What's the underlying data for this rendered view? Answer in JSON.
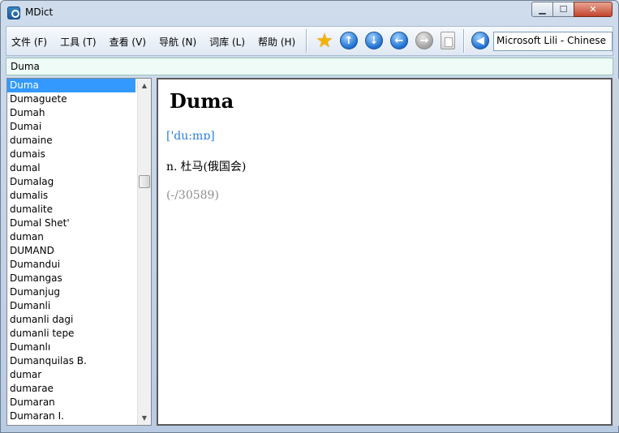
{
  "window": {
    "title": "MDict"
  },
  "menu": [
    {
      "label": "文件 (F)"
    },
    {
      "label": "工具 (T)"
    },
    {
      "label": "查看 (V)"
    },
    {
      "label": "导航 (N)"
    },
    {
      "label": "词库 (L)"
    },
    {
      "label": "帮助 (H)"
    }
  ],
  "toolbar": {
    "icons": [
      "star-icon",
      "arrow-up-icon",
      "arrow-down-icon",
      "arrow-left-icon",
      "arrow-right-icon",
      "paste-icon",
      "speaker-icon"
    ],
    "voice": "Microsoft Lili - Chinese"
  },
  "search": {
    "value": "Duma"
  },
  "word_list": {
    "selected": "Duma",
    "items": [
      "Duma",
      "Dumaguete",
      "Dumah",
      "Dumai",
      "dumaine",
      "dumais",
      "dumal",
      "Dumalag",
      "dumalis",
      "dumalite",
      "Dumal Shet'",
      "duman",
      "DUMAND",
      "Dumandui",
      "Dumangas",
      "Dumanjug",
      "Dumanli",
      "dumanli dagi",
      "dumanli tepe",
      "Dumanlı",
      "Dumanquilas B.",
      "dumar",
      "dumarae",
      "Dumaran",
      "Dumaran I."
    ]
  },
  "entry": {
    "headword": "Duma",
    "pronunciation": "['du:mɒ]",
    "part_of_speech": "n.",
    "definition": "杜马(俄国会)",
    "index": "(-/30589)"
  },
  "colors": {
    "selection": "#3399ff",
    "pronunciation": "#2a7fd8",
    "index": "#8c8c8c"
  }
}
